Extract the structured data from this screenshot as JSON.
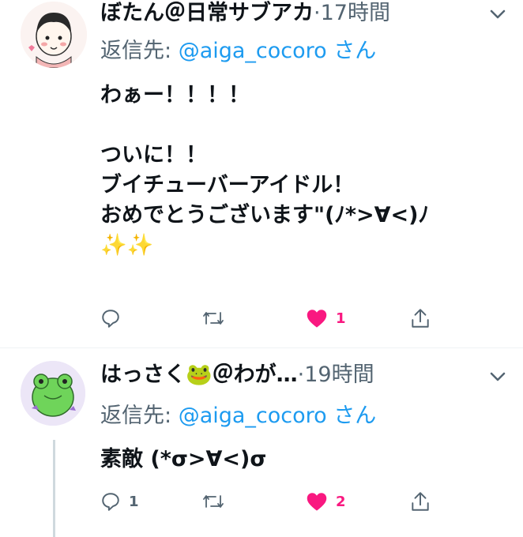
{
  "tweets": [
    {
      "author_name": "ぼたん＠日常サブアカ",
      "dot": "·",
      "time": "17時間",
      "reply_prefix": "返信先:",
      "reply_handle": "@aiga_cocoro",
      "reply_suffix": "さん",
      "text": "わぁー！！！！\n\nついに！！\nブイチューバーアイドル！\nおめでとうございます\"(ﾉ*>∀<)ﾉ\n✨✨",
      "reply_count": "",
      "retweet_count": "",
      "like_count": "1",
      "liked": true
    },
    {
      "author_name": "はっさく🐸＠わが…",
      "dot": "·",
      "time": "19時間",
      "reply_prefix": "返信先:",
      "reply_handle": "@aiga_cocoro",
      "reply_suffix": "さん",
      "text": "素敵 (*σ>∀<)σ",
      "reply_count": "1",
      "retweet_count": "",
      "like_count": "2",
      "liked": true
    }
  ],
  "icons": {
    "reply": "reply-icon",
    "retweet": "retweet-icon",
    "like": "heart-icon",
    "share": "share-icon",
    "menu": "chevron-down-icon"
  },
  "colors": {
    "like": "#f91880",
    "handle": "#1d9bf0",
    "muted": "#536471"
  }
}
